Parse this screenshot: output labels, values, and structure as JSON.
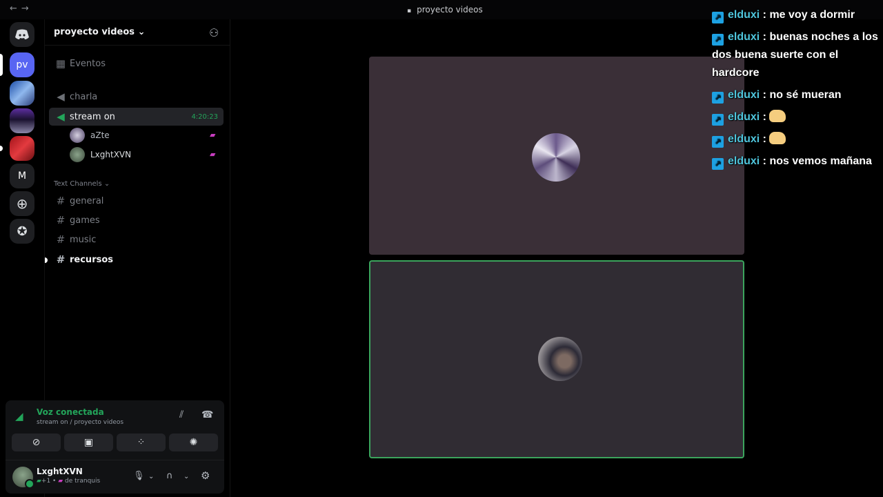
{
  "titlebar": {
    "title": "proyecto videos",
    "back_icon": "arrow-left-icon",
    "forward_icon": "arrow-right-icon"
  },
  "servers": [
    {
      "name": "home",
      "icon": "discord-logo-icon"
    },
    {
      "label": "pv",
      "color": "#5865f2"
    },
    {
      "name": "server-blue"
    },
    {
      "name": "server-purple"
    },
    {
      "name": "server-red"
    },
    {
      "label": "M"
    },
    {
      "icon": "plus-icon"
    },
    {
      "icon": "compass-icon"
    }
  ],
  "sidebar": {
    "server_name": "proyecto videos",
    "events_label": "Eventos",
    "voice_channels": [
      {
        "name": "charla"
      },
      {
        "name": "stream on",
        "timer": "4:20:23",
        "active": true
      }
    ],
    "voice_users": [
      {
        "name": "aZte"
      },
      {
        "name": "LxghtXVN"
      }
    ],
    "category": "Text Channels",
    "text_channels": [
      {
        "name": "general"
      },
      {
        "name": "games"
      },
      {
        "name": "music"
      },
      {
        "name": "recursos"
      }
    ]
  },
  "voice_panel": {
    "status": "Voz conectada",
    "location": "stream on / proyecto videos"
  },
  "user": {
    "name": "LxghtXVN",
    "status_prefix": "+1 •",
    "status_text": "de tranquis"
  },
  "chat": [
    {
      "user": "elduxi",
      "text": "me voy a dormir"
    },
    {
      "user": "elduxi",
      "text": "buenas noches a los dos buena suerte con el hardcore"
    },
    {
      "user": "elduxi",
      "text": "no sé mueran"
    },
    {
      "user": "elduxi",
      "text": "",
      "emoji": "flexed-arm-emoji"
    },
    {
      "user": "elduxi",
      "text": "",
      "emoji": "flexed-arm-emoji"
    },
    {
      "user": "elduxi",
      "text": "nos vemos mañana"
    }
  ],
  "colors": {
    "accent_green": "#23a55a",
    "stream_pink": "#c73dbf",
    "chat_user": "#4ec5dc"
  }
}
